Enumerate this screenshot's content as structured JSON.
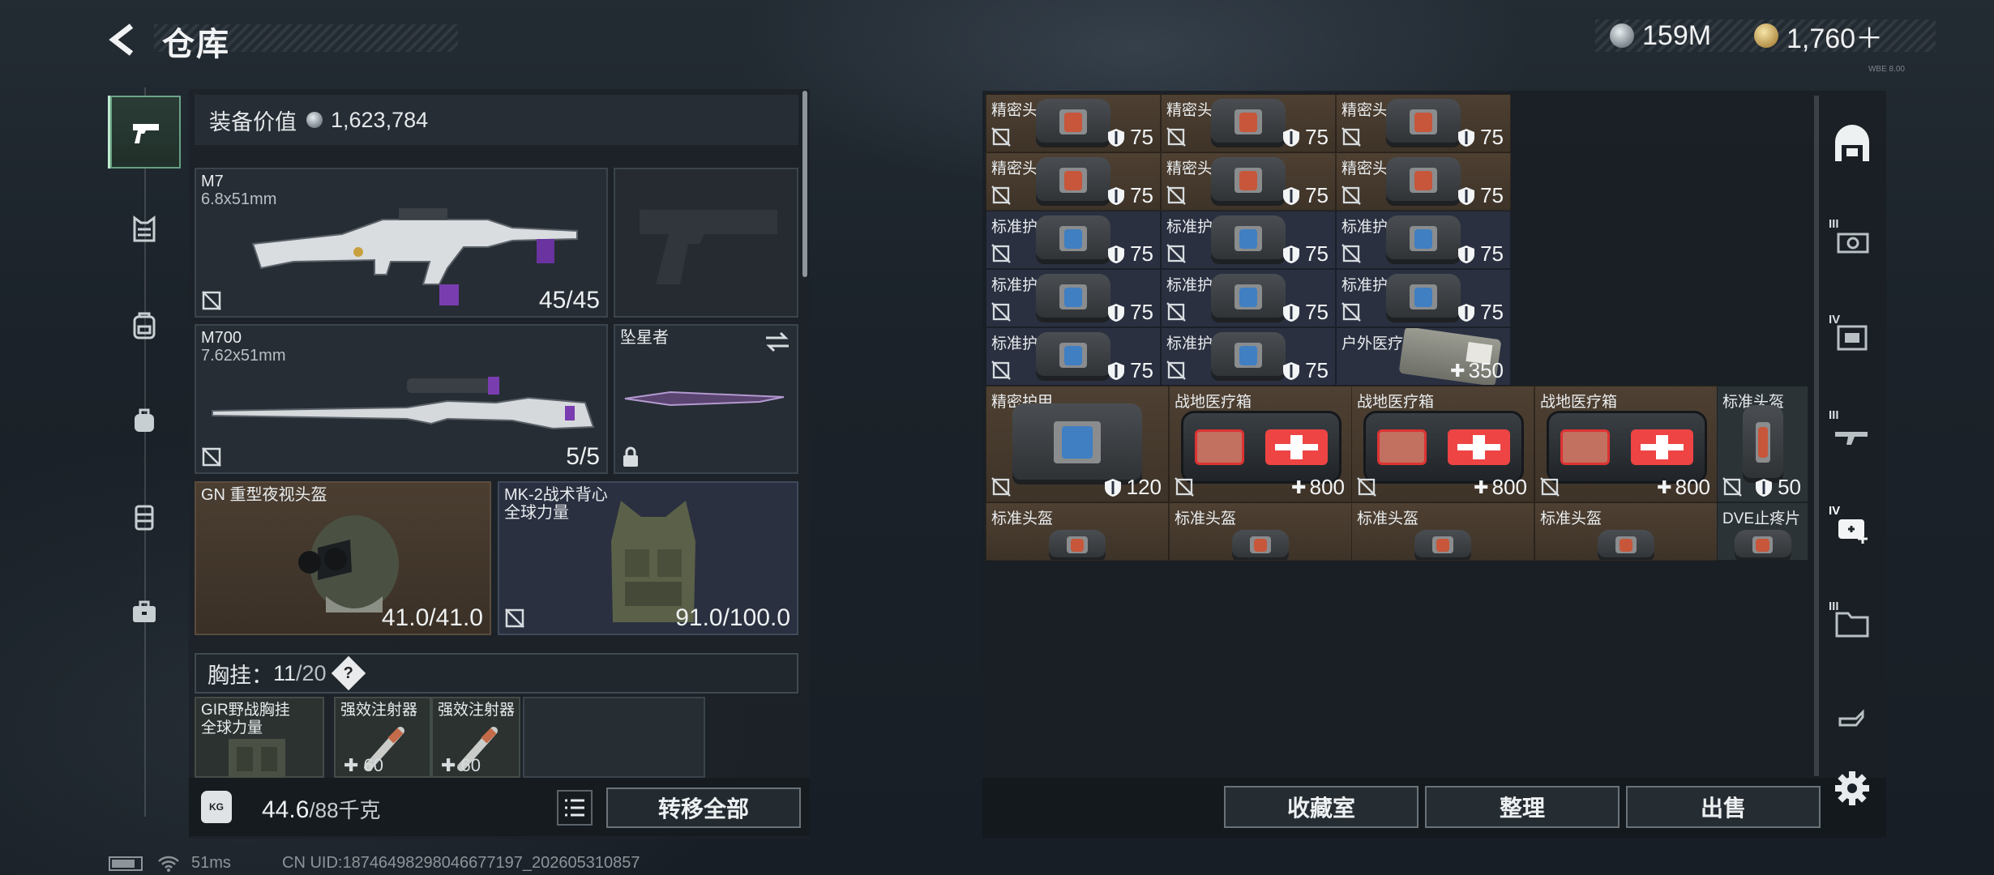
{
  "header": {
    "title": "仓库"
  },
  "currency": {
    "silver": "159M",
    "gold": "1,760＋",
    "tiny_id": "WBE 8.00"
  },
  "equipment_value": {
    "label": "装备价值",
    "value": "1,623,784"
  },
  "slots": {
    "primary": {
      "name": "M7",
      "caliber": "6.8x51mm",
      "ammo": "45/45"
    },
    "secondary": {
      "name": "M700",
      "caliber": "7.62x51mm",
      "ammo": "5/5"
    },
    "melee": {
      "name": "坠星者"
    },
    "helmet": {
      "name": "GN 重型夜视头盔",
      "durability": "41.0/41.0"
    },
    "armor": {
      "name": "MK-2战术背心",
      "subtitle": "全球力量",
      "durability": "91.0/100.0"
    }
  },
  "chest_rig": {
    "label": "胸挂：",
    "count": "11",
    "capacity": "/20",
    "help": "?"
  },
  "pockets": [
    {
      "name": "GIR野战胸挂",
      "subtitle": "全球力量"
    },
    {
      "name": "强效注射器",
      "value": "60"
    },
    {
      "name": "强效注射器",
      "value": "60"
    }
  ],
  "capacity": {
    "current": "44.6",
    "max": "/88千克",
    "icon_label": "KG",
    "transfer_all": "转移全部"
  },
  "status": {
    "ping": "51ms",
    "uid": "CN UID:18746498298046677197_202605310857"
  },
  "stash": {
    "rows": [
      [
        {
          "name": "精密头盔",
          "value": "75",
          "type": "shield",
          "color": "brown"
        },
        {
          "name": "精密头盔",
          "value": "75",
          "type": "shield",
          "color": "brown"
        },
        {
          "name": "精密头盔",
          "value": "75",
          "type": "shield",
          "color": "brown"
        }
      ],
      [
        {
          "name": "精密头盔",
          "value": "75",
          "type": "shield",
          "color": "brown"
        },
        {
          "name": "精密头盔",
          "value": "75",
          "type": "shield",
          "color": "brown"
        },
        {
          "name": "精密头盔",
          "value": "75",
          "type": "shield",
          "color": "brown"
        }
      ],
      [
        {
          "name": "标准护甲",
          "value": "75",
          "type": "shield",
          "color": "navy"
        },
        {
          "name": "标准护甲",
          "value": "75",
          "type": "shield",
          "color": "navy"
        },
        {
          "name": "标准护甲",
          "value": "75",
          "type": "shield",
          "color": "navy"
        }
      ],
      [
        {
          "name": "标准护甲",
          "value": "75",
          "type": "shield",
          "color": "navy"
        },
        {
          "name": "标准护甲",
          "value": "75",
          "type": "shield",
          "color": "navy"
        },
        {
          "name": "标准护甲",
          "value": "75",
          "type": "shield",
          "color": "navy"
        }
      ],
      [
        {
          "name": "标准护甲",
          "value": "75",
          "type": "shield",
          "color": "navy"
        },
        {
          "name": "标准护甲",
          "value": "75",
          "type": "shield",
          "color": "navy"
        },
        {
          "name": "户外医疗箱",
          "value": "350",
          "type": "plus",
          "color": "navy"
        }
      ]
    ],
    "row6": [
      {
        "name": "精密护甲",
        "value": "120",
        "type": "shield"
      },
      {
        "name": "战地医疗箱",
        "value": "800",
        "type": "plus"
      },
      {
        "name": "战地医疗箱",
        "value": "800",
        "type": "plus"
      },
      {
        "name": "战地医疗箱",
        "value": "800",
        "type": "plus"
      },
      {
        "name": "标准头盔",
        "value": "50",
        "type": "shield"
      }
    ],
    "row7": [
      "标准头盔",
      "标准头盔",
      "标准头盔",
      "标准头盔",
      "DVE止疼片"
    ],
    "buttons": {
      "collection": "收藏室",
      "sort": "整理",
      "sell": "出售"
    }
  },
  "right_tabs": [
    "III",
    "IV",
    "III",
    "IV",
    "III"
  ]
}
